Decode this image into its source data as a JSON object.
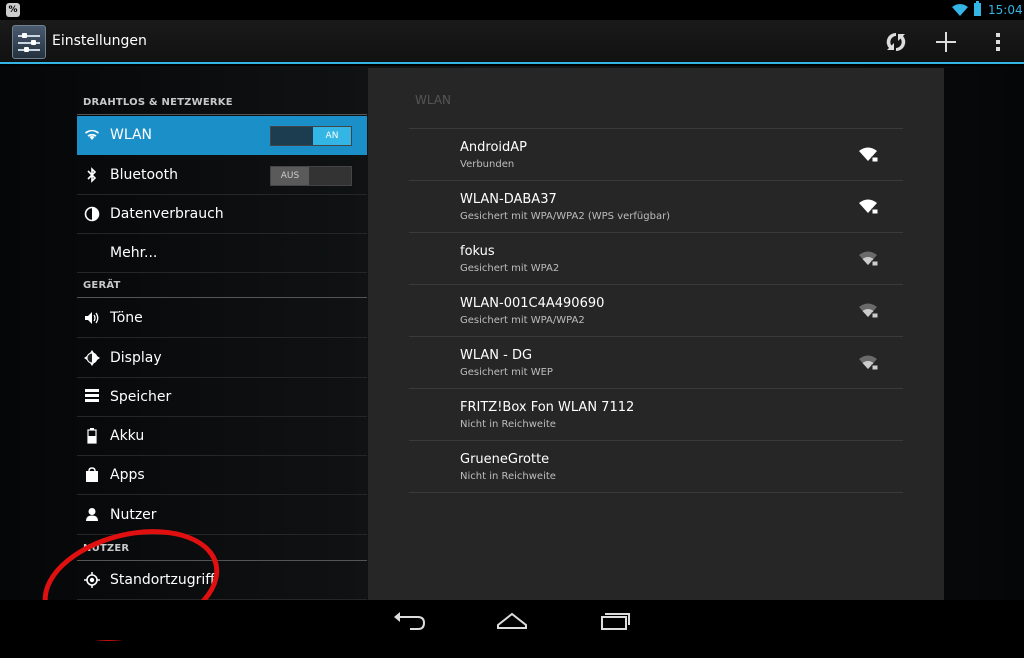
{
  "status_bar": {
    "notification_icon": "percent-notification-icon",
    "wifi_icon": "wifi-status-icon",
    "battery_icon": "battery-icon",
    "time": "15:04",
    "accent": "#33b5e5"
  },
  "action_bar": {
    "title": "Einstellungen",
    "app_icon": "settings-sliders-icon",
    "actions": [
      "wps-icon",
      "add-icon",
      "overflow-menu-icon"
    ]
  },
  "sidebar": {
    "sections": [
      {
        "header": "DRAHTLOS & NETZWERKE",
        "items": [
          {
            "label": "WLAN",
            "icon": "wifi-icon",
            "selected": true,
            "toggle": "AN"
          },
          {
            "label": "Bluetooth",
            "icon": "bluetooth-icon",
            "toggle": "AUS"
          },
          {
            "label": "Datenverbrauch",
            "icon": "data-usage-icon"
          },
          {
            "label": "Mehr...",
            "icon": ""
          }
        ]
      },
      {
        "header": "GERÄT",
        "items": [
          {
            "label": "Töne",
            "icon": "sound-icon"
          },
          {
            "label": "Display",
            "icon": "display-icon"
          },
          {
            "label": "Speicher",
            "icon": "storage-icon"
          },
          {
            "label": "Akku",
            "icon": "battery-icon"
          },
          {
            "label": "Apps",
            "icon": "apps-icon"
          },
          {
            "label": "Nutzer",
            "icon": "user-icon"
          }
        ]
      },
      {
        "header": "NUTZER",
        "items": [
          {
            "label": "Standortzugriff",
            "icon": "location-icon"
          }
        ]
      }
    ]
  },
  "wlan_panel": {
    "title": "WLAN",
    "networks": [
      {
        "name": "AndroidAP",
        "status": "Verbunden",
        "signal": "strong"
      },
      {
        "name": "WLAN-DABA37",
        "status": "Gesichert mit WPA/WPA2 (WPS verfügbar)",
        "signal": "strong"
      },
      {
        "name": "fokus",
        "status": "Gesichert mit WPA2",
        "signal": "weak"
      },
      {
        "name": "WLAN-001C4A490690",
        "status": "Gesichert mit WPA/WPA2",
        "signal": "weak"
      },
      {
        "name": "WLAN - DG",
        "status": "Gesichert mit WEP",
        "signal": "weak"
      },
      {
        "name": "FRITZ!Box Fon WLAN 7112",
        "status": "Nicht in Reichweite",
        "signal": "none"
      },
      {
        "name": "GrueneGrotte",
        "status": "Nicht in Reichweite",
        "signal": "none"
      }
    ]
  },
  "annotation": {
    "shape": "red-circle",
    "color": "#e01010",
    "target": "Nutzer"
  },
  "nav_bar": {
    "buttons": [
      "back-icon",
      "home-icon",
      "recent-apps-icon"
    ]
  }
}
